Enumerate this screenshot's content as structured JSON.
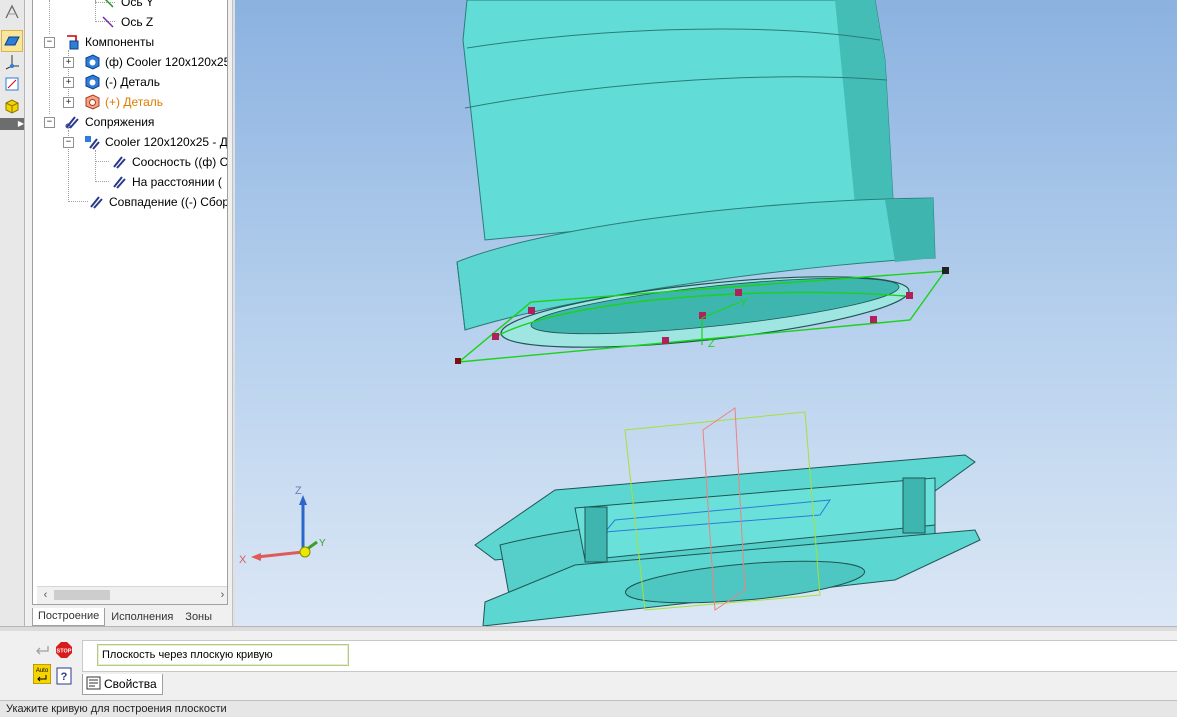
{
  "tree": {
    "items": [
      {
        "label": "Ось Y"
      },
      {
        "label": "Ось Z"
      },
      {
        "label": "Компоненты"
      },
      {
        "label": "(ф) Cooler 120x120x25"
      },
      {
        "label": "(-) Деталь"
      },
      {
        "label": "(+) Деталь"
      },
      {
        "label": "Сопряжения"
      },
      {
        "label": "Cooler 120x120x25 - Д"
      },
      {
        "label": "Соосность ((ф) C"
      },
      {
        "label": "На расстоянии ("
      },
      {
        "label": "Совпадение ((-) Сбор"
      }
    ],
    "expander_plus": "+",
    "expander_minus": "−"
  },
  "panel_tabs": [
    "Построение",
    "Исполнения",
    "Зоны"
  ],
  "scroll": {
    "left": "‹",
    "right": "›"
  },
  "viewport": {
    "triad": {
      "x": "X",
      "y": "Y",
      "z": "Z"
    }
  },
  "command": {
    "input_value": "Плоскость через плоскую кривую",
    "properties_tab": "Свойства",
    "stop_label": "STOP",
    "auto_label": "Auto",
    "help_label": "?"
  },
  "status": {
    "text": "Укажите кривую для построения плоскости"
  },
  "colors": {
    "model": "#5fd8d2",
    "model_shadow": "#3fb5b0",
    "selection_green": "#19d319",
    "viewport_top": "#8bb2e0",
    "viewport_bottom": "#dbe7f5",
    "orange_text": "#e07b00"
  },
  "icons": [
    "line-y-icon",
    "line-z-icon",
    "components-icon",
    "part-icon",
    "mates-icon",
    "mate-icon",
    "stop-icon",
    "auto-icon",
    "help-icon",
    "properties-icon",
    "plane-icon",
    "axis-icon",
    "sketch-icon",
    "cube-icon"
  ]
}
